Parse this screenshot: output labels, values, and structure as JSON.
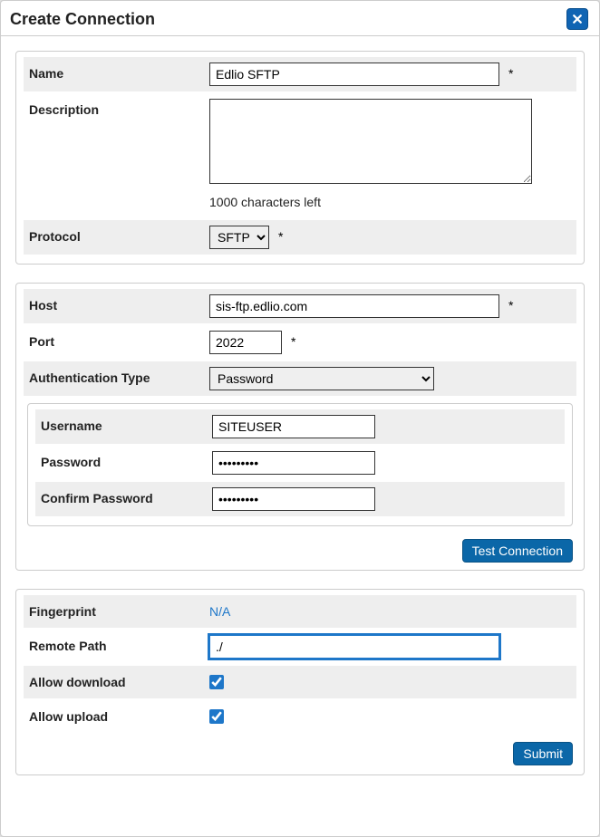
{
  "dialog": {
    "title": "Create Connection"
  },
  "labels": {
    "name": "Name",
    "description": "Description",
    "protocol": "Protocol",
    "host": "Host",
    "port": "Port",
    "authType": "Authentication Type",
    "username": "Username",
    "password": "Password",
    "confirmPassword": "Confirm Password",
    "fingerprint": "Fingerprint",
    "remotePath": "Remote Path",
    "allowDownload": "Allow download",
    "allowUpload": "Allow upload",
    "charsLeft": "1000 characters left"
  },
  "values": {
    "name": "Edlio SFTP",
    "description": "",
    "protocol": "SFTP",
    "host": "sis-ftp.edlio.com",
    "port": "2022",
    "authType": "Password",
    "username": "SITEUSER",
    "password": "•••••••••",
    "confirmPassword": "•••••••••",
    "fingerprint": "N/A",
    "remotePath": "./"
  },
  "options": {
    "protocol": [
      "SFTP"
    ],
    "authType": [
      "Password"
    ]
  },
  "buttons": {
    "testConnection": "Test Connection",
    "submit": "Submit"
  },
  "marks": {
    "required": "*"
  }
}
